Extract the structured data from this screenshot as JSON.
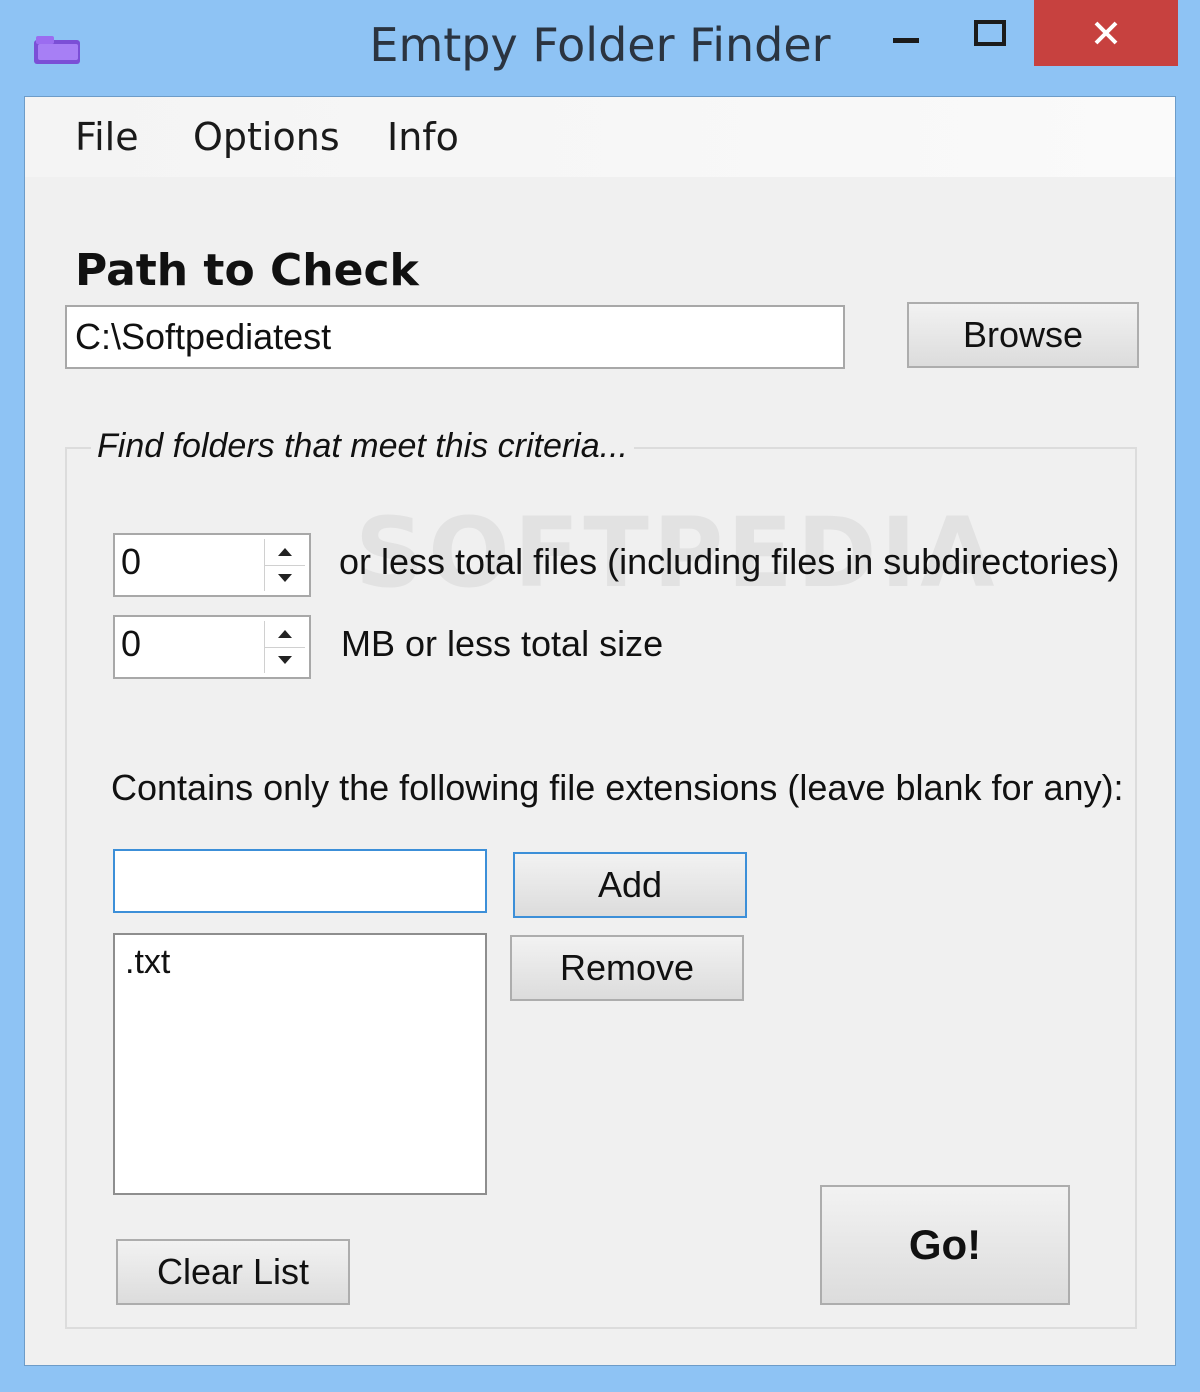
{
  "window": {
    "title": "Emtpy Folder Finder"
  },
  "menu": {
    "file": "File",
    "options": "Options",
    "info": "Info"
  },
  "path": {
    "label": "Path to Check",
    "value": "C:\\Softpediatest",
    "browse_label": "Browse"
  },
  "criteria": {
    "legend": "Find folders that meet this criteria...",
    "files_count": "0",
    "files_label": "or less total files (including files in subdirectories)",
    "size_mb": "0",
    "size_label": "MB or less total size",
    "extensions_label": "Contains only the following file extensions (leave blank for any):",
    "extension_input": "",
    "add_label": "Add",
    "remove_label": "Remove",
    "extensions": [
      ".txt"
    ],
    "clear_label": "Clear List",
    "go_label": "Go!"
  },
  "watermark": "SOFTPEDIA",
  "colors": {
    "frame": "#8ec3f4",
    "close_button": "#c7413f",
    "client_bg": "#f0f0f0",
    "focus_border": "#3c8fd8"
  }
}
